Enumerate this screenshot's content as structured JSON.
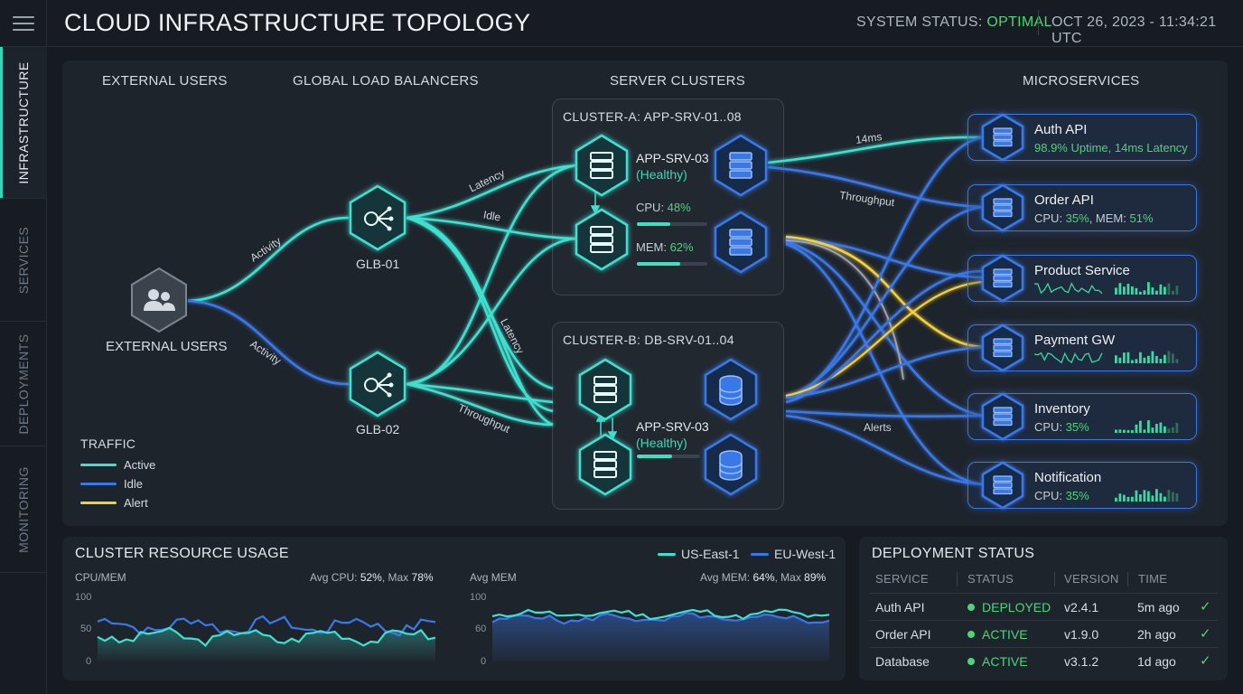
{
  "header": {
    "title": "CLOUD INFRASTRUCTURE TOPOLOGY",
    "status_label": "SYSTEM STATUS: ",
    "status_value": "OPTIMAL",
    "datetime": "OCT 26, 2023 - 11:34:21 UTC"
  },
  "nav": {
    "items": [
      {
        "label": "INFRASTRUCTURE",
        "active": true
      },
      {
        "label": "SERVICES",
        "active": false
      },
      {
        "label": "DEPLOYMENTS",
        "active": false
      },
      {
        "label": "MONITORING",
        "active": false
      }
    ]
  },
  "topology": {
    "columns": [
      "EXTERNAL USERS",
      "GLOBAL LOAD BALANCERS",
      "SERVER CLUSTERS",
      "MICROSERVICES"
    ],
    "external_users_label": "EXTERNAL USERS",
    "glb": [
      "GLB-01",
      "GLB-02"
    ],
    "edge_labels": {
      "users_glb1": "Activity",
      "users_glb2": "Activity",
      "latency_top": "Latency",
      "idle": "Idle",
      "latency_mid": "Latency",
      "throughput_low": "Throughput",
      "ms14": "14ms",
      "throughput_right": "Throughput",
      "alerts": "Alerts"
    },
    "cluster_a": {
      "label": "CLUSTER-A: APP-SRV-01..08",
      "server_name": "APP-SRV-03",
      "server_health": "(Healthy)",
      "cpu_label": "CPU: ",
      "cpu_value": "48%",
      "cpu_pct": 0.48,
      "mem_label": "MEM: ",
      "mem_value": "62%",
      "mem_pct": 0.62
    },
    "cluster_b": {
      "label": "CLUSTER-B: DB-SRV-01..04",
      "server_name": "APP-SRV-03",
      "server_health": "(Healthy)",
      "load_pct": 0.55
    },
    "services": [
      {
        "name": "Auth API",
        "sub": "98.9% Uptime, 14ms Latency",
        "sub_green": true
      },
      {
        "name": "Order API",
        "sub_prefix1": "CPU: ",
        "sub_val1": "35%",
        "sub_prefix2": ", MEM: ",
        "sub_val2": "51%"
      },
      {
        "name": "Product Service"
      },
      {
        "name": "Payment GW"
      },
      {
        "name": "Inventory",
        "sub_prefix1": "CPU: ",
        "sub_val1": "35%"
      },
      {
        "name": "Notification",
        "sub_prefix1": "CPU: ",
        "sub_val1": "35%"
      }
    ],
    "legend": {
      "title": "TRAFFIC",
      "items": [
        {
          "label": "Active",
          "color": "#3fe0d0"
        },
        {
          "label": "Idle",
          "color": "#3b78e7"
        },
        {
          "label": "Alert",
          "color": "#f2d13b"
        }
      ]
    }
  },
  "usage": {
    "title": "CLUSTER RESOURCE USAGE",
    "legend": [
      {
        "label": "US-East-1",
        "color": "#3fe0d0"
      },
      {
        "label": "EU-West-1",
        "color": "#3b78e7"
      }
    ],
    "left": {
      "label": "CPU/MEM",
      "avg_label": "Avg CPU: ",
      "avg": "52%",
      "max_label": ", Max ",
      "max": "78%",
      "ticks": [
        "100",
        "50",
        "0"
      ]
    },
    "right": {
      "label": "Avg MEM",
      "avg_label": "Avg MEM: ",
      "avg": "64%",
      "max_label": ", Max ",
      "max": "89%",
      "ticks": [
        "100",
        "60",
        "0"
      ]
    }
  },
  "deploy": {
    "title": "DEPLOYMENT STATUS",
    "headers": [
      "SERVICE",
      "STATUS",
      "VERSION",
      "TIME"
    ],
    "rows": [
      {
        "service": "Auth API",
        "status": "DEPLOYED",
        "version": "v2.4.1",
        "time": "5m ago"
      },
      {
        "service": "Order API",
        "status": "ACTIVE",
        "version": "v1.9.0",
        "time": "2h ago"
      },
      {
        "service": "Database",
        "status": "ACTIVE",
        "version": "v3.1.2",
        "time": "1d ago"
      }
    ]
  },
  "colors": {
    "active": "#3fe0d0",
    "idle": "#3b78e7",
    "alert": "#f2d13b",
    "ok": "#4fd47a"
  }
}
